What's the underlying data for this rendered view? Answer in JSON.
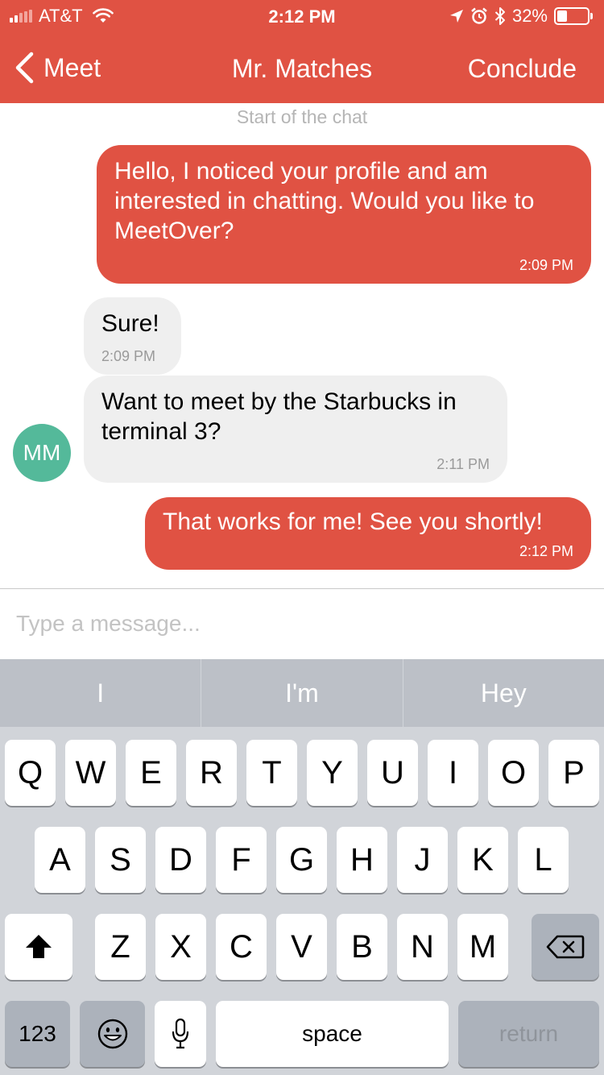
{
  "status_bar": {
    "carrier": "AT&T",
    "time": "2:12 PM",
    "battery_percent": "32%",
    "battery_level": 0.32,
    "signal_bars_filled": 2,
    "icons": [
      "wifi-icon",
      "location-arrow-icon",
      "alarm-icon",
      "bluetooth-icon",
      "battery-icon"
    ]
  },
  "nav": {
    "back_label": "Meet",
    "title": "Mr. Matches",
    "action_label": "Conclude"
  },
  "colors": {
    "brand": "#e05243",
    "incoming_bubble": "#efefef",
    "avatar": "#54b99a",
    "keyboard_bg": "#d1d4d9"
  },
  "chat": {
    "start_label": "Start of the chat",
    "avatar_initials": "MM",
    "messages": [
      {
        "direction": "outgoing",
        "text": "Hello, I noticed your profile and am interested in chatting. Would you like to MeetOver?",
        "time": "2:09 PM"
      },
      {
        "direction": "incoming",
        "text": "Sure!",
        "time": "2:09 PM"
      },
      {
        "direction": "incoming",
        "text": "Want to meet by the Starbucks in terminal 3?",
        "time": "2:11 PM"
      },
      {
        "direction": "outgoing",
        "text": "That works for me! See you shortly!",
        "time": "2:12 PM"
      }
    ]
  },
  "composer": {
    "placeholder": "Type a message..."
  },
  "keyboard": {
    "suggestions": [
      "I",
      "I'm",
      "Hey"
    ],
    "row1": [
      "Q",
      "W",
      "E",
      "R",
      "T",
      "Y",
      "U",
      "I",
      "O",
      "P"
    ],
    "row2": [
      "A",
      "S",
      "D",
      "F",
      "G",
      "H",
      "J",
      "K",
      "L"
    ],
    "row3": [
      "Z",
      "X",
      "C",
      "V",
      "B",
      "N",
      "M"
    ],
    "numbers_label": "123",
    "space_label": "space",
    "return_label": "return"
  }
}
